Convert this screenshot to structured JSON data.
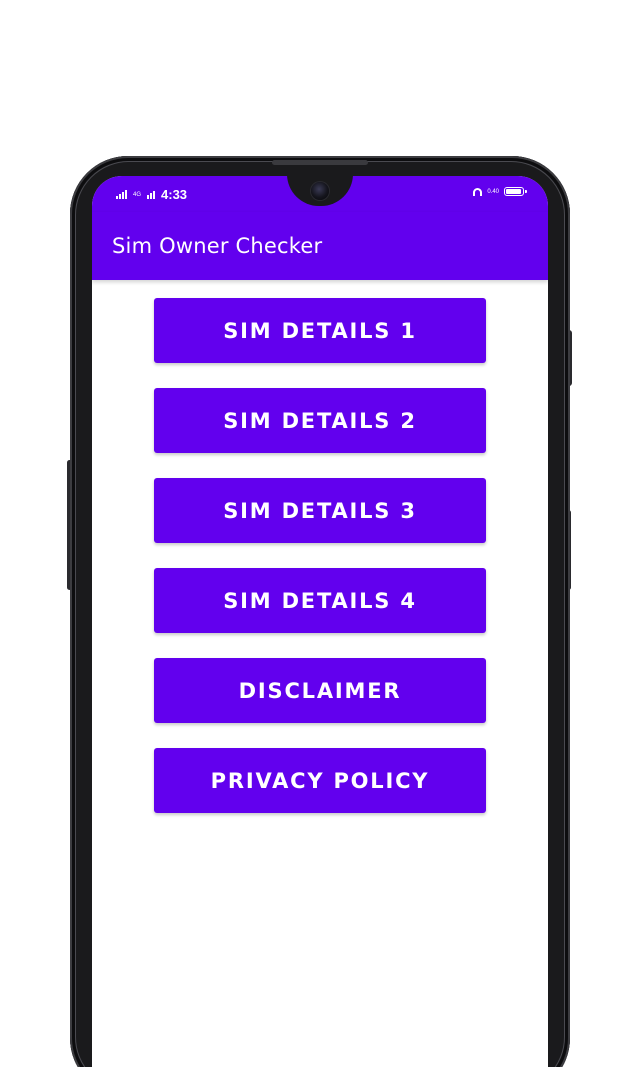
{
  "status_bar": {
    "time": "4:33",
    "left_small_text": "4G",
    "right_small_text": "0.40",
    "icons": [
      "signal-icon",
      "wifi-icon",
      "headphone-icon",
      "battery-icon"
    ]
  },
  "app_bar": {
    "title": "Sim Owner Checker"
  },
  "menu": {
    "buttons": [
      {
        "label": "SIM DETAILS 1"
      },
      {
        "label": "SIM DETAILS 2"
      },
      {
        "label": "SIM DETAILS 3"
      },
      {
        "label": "SIM DETAILS 4"
      },
      {
        "label": "DISCLAIMER"
      },
      {
        "label": "PRIVACY POLICY"
      }
    ]
  },
  "colors": {
    "primary": "#6200ee",
    "background": "#ffffff",
    "phone_frame": "#1a1a1c"
  }
}
